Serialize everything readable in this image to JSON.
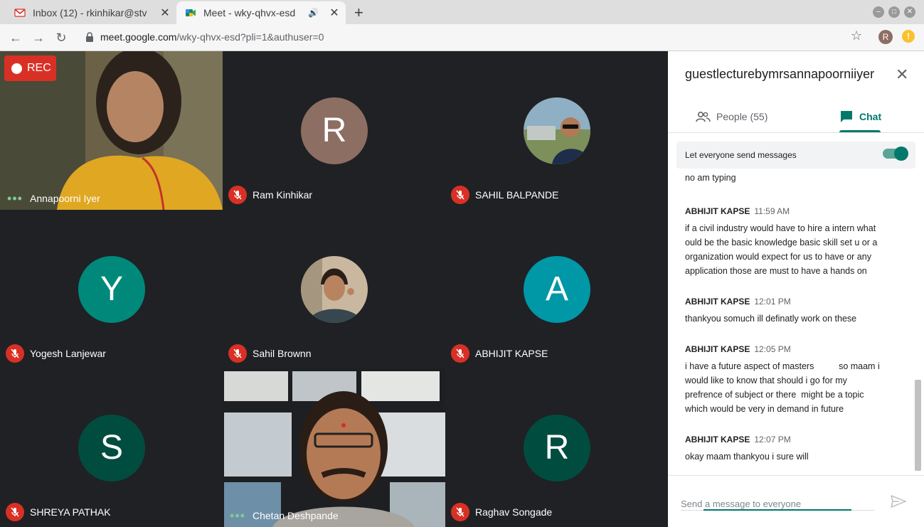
{
  "browser": {
    "tabs": [
      {
        "title": "Inbox (12) - rkinhikar@stv",
        "active": false
      },
      {
        "title": "Meet - wky-qhvx-esd",
        "active": true
      }
    ],
    "url_host": "meet.google.com",
    "url_path": "/wky-qhvx-esd?pli=1&authuser=0",
    "profile_initial": "R",
    "extension_glyph": "!"
  },
  "recording": {
    "label": "REC"
  },
  "participants": [
    {
      "name": "Annapoorni Iyer",
      "status": "speaking",
      "tile": "video"
    },
    {
      "name": "Ram Kinhikar",
      "status": "muted",
      "initial": "R",
      "color": "#8d6e63"
    },
    {
      "name": "SAHIL BALPANDE",
      "status": "muted",
      "tile": "photo"
    },
    {
      "name": "Yogesh Lanjewar",
      "status": "muted",
      "initial": "Y",
      "color": "#00897b"
    },
    {
      "name": "Sahil Brownn",
      "status": "muted",
      "tile": "photo"
    },
    {
      "name": "ABHIJIT KAPSE",
      "status": "muted",
      "initial": "A",
      "color": "#0097a7"
    },
    {
      "name": "SHREYA PATHAK",
      "status": "muted",
      "initial": "S",
      "color": "#004d40"
    },
    {
      "name": "Chetan Deshpande",
      "status": "speaking",
      "tile": "video"
    },
    {
      "name": "Raghav Songade",
      "status": "muted",
      "initial": "R",
      "color": "#004d40"
    }
  ],
  "panel": {
    "title": "guestlecturebymrsannapoorniiyer",
    "people_tab": "People (55)",
    "chat_tab": "Chat",
    "toggle_label": "Let everyone send messages",
    "toggle_on": true,
    "partial_message": "no am typing",
    "messages": [
      {
        "sender": "ABHIJIT KAPSE",
        "time": "11:59 AM",
        "lines": [
          "if a civil industry would have to hire a intern what",
          "ould be the basic knowledge basic skill set u or a",
          "organization would expect for us to have or any",
          "application those are must to have a hands on"
        ]
      },
      {
        "sender": "ABHIJIT KAPSE",
        "time": "12:01 PM",
        "lines": [
          "thankyou somuch ill definatly work  on  these"
        ]
      },
      {
        "sender": "ABHIJIT KAPSE",
        "time": "12:05 PM",
        "lines": [
          "i have a future aspect of masters          so maam i",
          "would like to know that should i go for my",
          "prefrence of subject or there  might be a topic",
          "which would be very in demand in future"
        ]
      },
      {
        "sender": "ABHIJIT KAPSE",
        "time": "12:07 PM",
        "lines": [
          "okay maam thankyou i sure will"
        ]
      }
    ],
    "compose_placeholder": "Send a message to everyone"
  },
  "colors": {
    "accent": "#00796b",
    "muted_red": "#d93025",
    "rec_red": "#d93025"
  }
}
